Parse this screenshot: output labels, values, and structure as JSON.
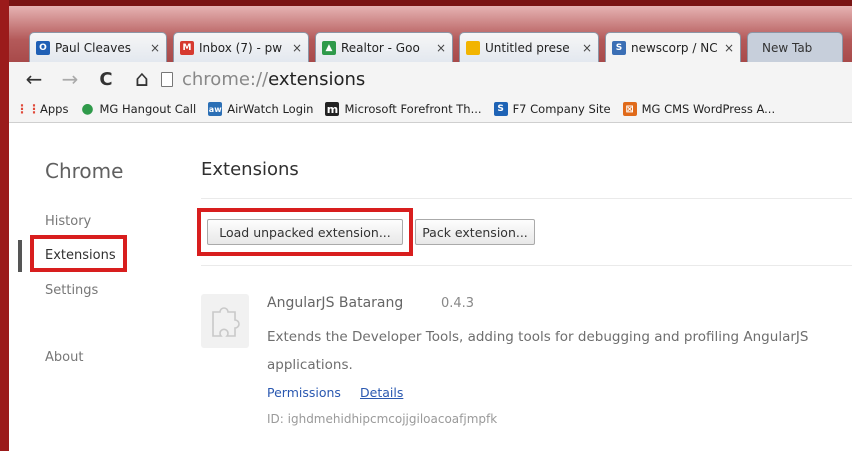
{
  "tabs": [
    {
      "title": "Paul Cleaves",
      "favicon": "outlook-icon",
      "color": "#1f5fb5",
      "glyph": "O"
    },
    {
      "title": "Inbox (7) - pw",
      "favicon": "gmail-icon",
      "color": "#d63a2f",
      "glyph": "M"
    },
    {
      "title": "Realtor - Goo",
      "favicon": "drive-icon",
      "color": "#2f9a4a",
      "glyph": "▲"
    },
    {
      "title": "Untitled prese",
      "favicon": "slides-icon",
      "color": "#f2b400",
      "glyph": ""
    },
    {
      "title": "newscorp / NC",
      "favicon": "database-icon",
      "color": "#3b6fb5",
      "glyph": "S"
    },
    {
      "title": "New Tab",
      "favicon": "",
      "color": "",
      "glyph": ""
    }
  ],
  "tab_close_glyph": "×",
  "toolbar": {
    "back_glyph": "←",
    "forward_glyph": "→",
    "reload_glyph": "C",
    "home_glyph": "⌂",
    "url_scheme": "chrome://",
    "url_path": "extensions"
  },
  "bookmarks": [
    {
      "label": "Apps",
      "icon": "apps-grid-icon",
      "color": "#e04a3a",
      "glyph": "⋮⋮"
    },
    {
      "label": "MG Hangout Call",
      "icon": "hangouts-icon",
      "color": "#2f9a4a",
      "glyph": "●"
    },
    {
      "label": "AirWatch Login",
      "icon": "airwatch-icon",
      "color": "#2b6fb5",
      "glyph": "aw"
    },
    {
      "label": "Microsoft Forefront Th...",
      "icon": "forefront-icon",
      "color": "#222222",
      "glyph": "m"
    },
    {
      "label": "F7 Company Site",
      "icon": "sharepoint-icon",
      "color": "#1e63b5",
      "glyph": "S"
    },
    {
      "label": "MG CMS WordPress A...",
      "icon": "wordpress-icon",
      "color": "#e06a1a",
      "glyph": "⊠"
    }
  ],
  "sidebar": {
    "title": "Chrome",
    "items": [
      "History",
      "Extensions",
      "Settings",
      "About"
    ]
  },
  "main": {
    "title": "Extensions",
    "load_unpacked_label": "Load unpacked extension...",
    "pack_label": "Pack extension..."
  },
  "extension": {
    "name": "AngularJS Batarang",
    "version": "0.4.3",
    "description": "Extends the Developer Tools, adding tools for debugging and profiling AngularJS applications.",
    "permissions_label": "Permissions",
    "details_label": "Details",
    "id_text": "ID: ighdmehidhipcmcojjgiloacoafjmpfk",
    "icon": "puzzle-piece-icon"
  },
  "colors": {
    "highlight_box": "#d81e1e",
    "link": "#2a58b0",
    "window_frame": "#9b1b1b"
  }
}
